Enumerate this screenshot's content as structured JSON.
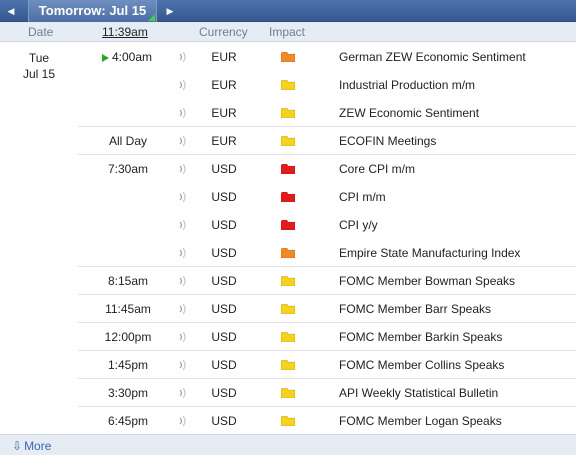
{
  "nav": {
    "prev_icon": "◀",
    "next_icon": "▶",
    "title": "Tomorrow: Jul 15"
  },
  "columns": {
    "date": "Date",
    "time": "11:39am",
    "currency": "Currency",
    "impact": "Impact"
  },
  "date": {
    "day": "Tue",
    "date": "Jul 15"
  },
  "impact_colors": {
    "orange": "#f08a24",
    "yellow": "#f3d320",
    "red": "#e31a1a"
  },
  "rows": [
    {
      "time": "4:00am",
      "currency": "EUR",
      "impact": "orange",
      "event": "German ZEW Economic Sentiment",
      "current": true
    },
    {
      "time": "",
      "currency": "EUR",
      "impact": "yellow",
      "event": "Industrial Production m/m"
    },
    {
      "time": "",
      "currency": "EUR",
      "impact": "yellow",
      "event": "ZEW Economic Sentiment"
    },
    {
      "time": "All Day",
      "currency": "EUR",
      "impact": "yellow",
      "event": "ECOFIN Meetings"
    },
    {
      "time": "7:30am",
      "currency": "USD",
      "impact": "red",
      "event": "Core CPI m/m"
    },
    {
      "time": "",
      "currency": "USD",
      "impact": "red",
      "event": "CPI m/m"
    },
    {
      "time": "",
      "currency": "USD",
      "impact": "red",
      "event": "CPI y/y"
    },
    {
      "time": "",
      "currency": "USD",
      "impact": "orange",
      "event": "Empire State Manufacturing Index"
    },
    {
      "time": "8:15am",
      "currency": "USD",
      "impact": "yellow",
      "event": "FOMC Member Bowman Speaks"
    },
    {
      "time": "11:45am",
      "currency": "USD",
      "impact": "yellow",
      "event": "FOMC Member Barr Speaks"
    },
    {
      "time": "12:00pm",
      "currency": "USD",
      "impact": "yellow",
      "event": "FOMC Member Barkin Speaks"
    },
    {
      "time": "1:45pm",
      "currency": "USD",
      "impact": "yellow",
      "event": "FOMC Member Collins Speaks"
    },
    {
      "time": "3:30pm",
      "currency": "USD",
      "impact": "yellow",
      "event": "API Weekly Statistical Bulletin"
    },
    {
      "time": "6:45pm",
      "currency": "USD",
      "impact": "yellow",
      "event": "FOMC Member Logan Speaks"
    }
  ],
  "footer": {
    "more_icon": "⇩",
    "more_label": "More"
  }
}
